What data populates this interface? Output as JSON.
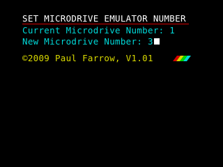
{
  "screen": {
    "title": "SET MICRODRIVE EMULATOR NUMBER",
    "current_label": "Current Microdrive Number: 1",
    "new_label": "New Microdrive Number: 3",
    "copyright": "©2009 Paul Farrow, V1.01"
  },
  "colors": {
    "background": "#000000",
    "title_text": "#ffffff",
    "title_underline": "#d40000",
    "info_text": "#00d8d8",
    "copyright_text": "#d8d800",
    "cursor": "#ffffff",
    "stripes": [
      "#d40000",
      "#d8d800",
      "#00d800",
      "#00d8d8"
    ]
  },
  "icons": {
    "cursor": "block-cursor-icon",
    "logo": "spectrum-rainbow-stripes-icon"
  }
}
